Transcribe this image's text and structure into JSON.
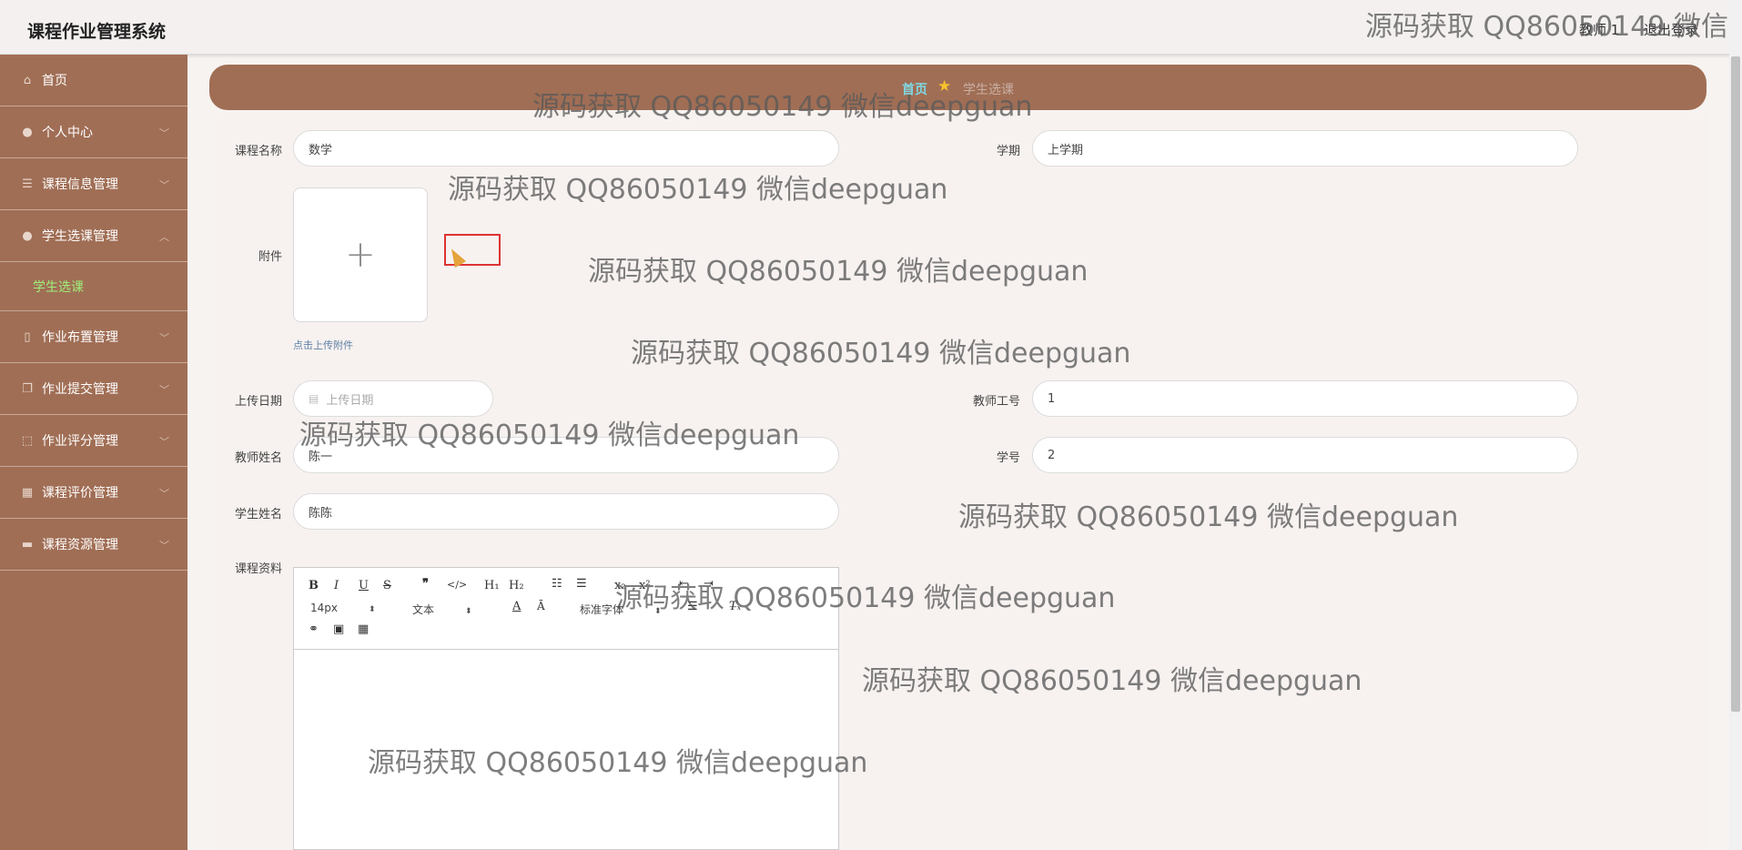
{
  "header": {
    "app_title": "课程作业管理系统",
    "user_name": "教师 1",
    "logout_label": "退出登录"
  },
  "sidebar": {
    "items": [
      {
        "label": "首页",
        "icon": "home-icon"
      },
      {
        "label": "个人中心",
        "icon": "user-icon"
      },
      {
        "label": "课程信息管理",
        "icon": "list-icon"
      },
      {
        "label": "学生选课管理",
        "icon": "user-icon"
      },
      {
        "label": "作业布置管理",
        "icon": "phone-icon"
      },
      {
        "label": "作业提交管理",
        "icon": "copy-icon"
      },
      {
        "label": "作业评分管理",
        "icon": "frame-icon"
      },
      {
        "label": "课程评价管理",
        "icon": "grid-icon"
      },
      {
        "label": "课程资源管理",
        "icon": "monitor-icon"
      }
    ],
    "active_sub": "学生选课"
  },
  "breadcrumb": {
    "home": "首页",
    "current": "学生选课"
  },
  "form": {
    "course_name_label": "课程名称",
    "course_name_value": "数学",
    "term_label": "学期",
    "term_value": "上学期",
    "attachment_label": "附件",
    "upload_plus": "+",
    "upload_hint": "点击上传附件",
    "upload_date_label": "上传日期",
    "upload_date_placeholder": "上传日期",
    "teacher_id_label": "教师工号",
    "teacher_id_value": "1",
    "teacher_name_label": "教师姓名",
    "teacher_name_value": "陈一",
    "student_id_label": "学号",
    "student_id_value": "2",
    "student_name_label": "学生姓名",
    "student_name_value": "陈陈",
    "course_material_label": "课程资料"
  },
  "editor": {
    "font_size": "14px",
    "paragraph": "文本",
    "font_family": "标准字体"
  },
  "watermark": "源码获取 QQ86050149 微信deepguan"
}
